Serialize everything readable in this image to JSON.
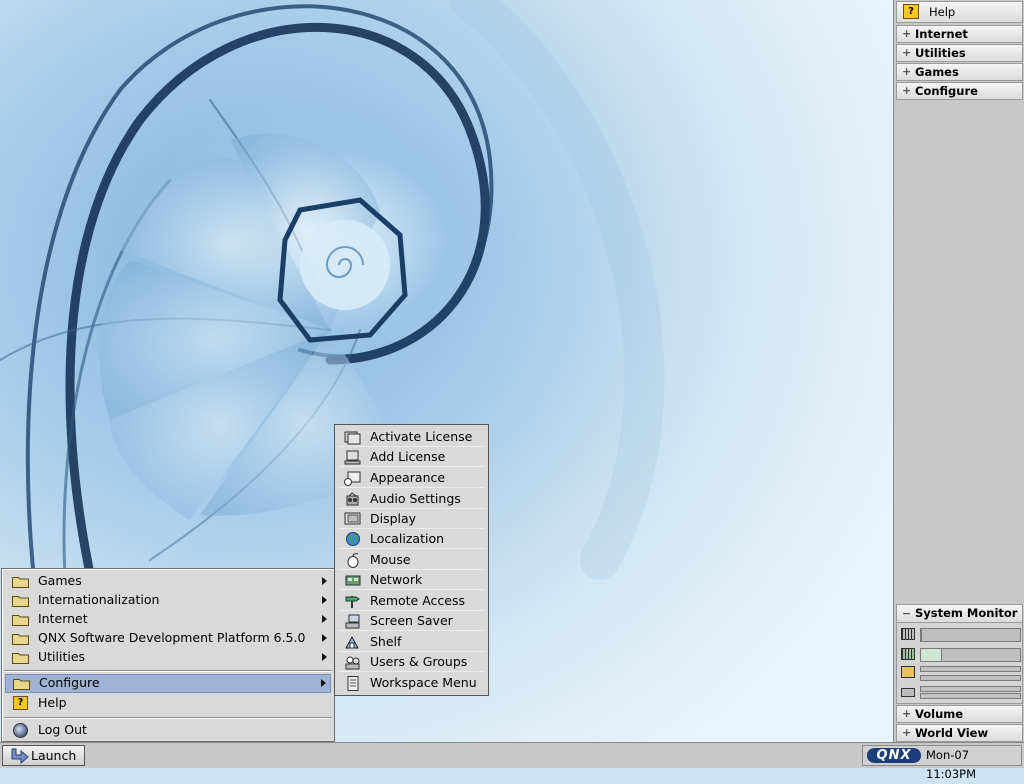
{
  "shelf": {
    "help_label": "Help",
    "groups": [
      {
        "label": "Internet"
      },
      {
        "label": "Utilities"
      },
      {
        "label": "Games"
      },
      {
        "label": "Configure"
      }
    ],
    "system_monitor": {
      "title": "System Monitor",
      "cpu_level": 0,
      "memory_level": 0.2
    },
    "volume_label": "Volume",
    "world_view_label": "World View"
  },
  "launch_menu": {
    "items": [
      {
        "label": "Games",
        "icon": "folder-icon",
        "submenu": true
      },
      {
        "label": "Internationalization",
        "icon": "folder-icon",
        "submenu": true
      },
      {
        "label": "Internet",
        "icon": "folder-icon",
        "submenu": true
      },
      {
        "label": "QNX Software Development Platform 6.5.0",
        "icon": "folder-icon",
        "submenu": true
      },
      {
        "label": "Utilities",
        "icon": "folder-icon",
        "submenu": true
      }
    ],
    "configure_label": "Configure",
    "help_label": "Help",
    "logout_label": "Log Out"
  },
  "configure_menu": {
    "items": [
      {
        "label": "Activate License",
        "icon": "license-icon"
      },
      {
        "label": "Add License",
        "icon": "computer-icon"
      },
      {
        "label": "Appearance",
        "icon": "appearance-icon"
      },
      {
        "label": "Audio Settings",
        "icon": "audio-icon"
      },
      {
        "label": "Display",
        "icon": "display-icon"
      },
      {
        "label": "Localization",
        "icon": "globe-icon"
      },
      {
        "label": "Mouse",
        "icon": "mouse-icon"
      },
      {
        "label": "Network",
        "icon": "network-card-icon"
      },
      {
        "label": "Remote Access",
        "icon": "remote-access-icon"
      },
      {
        "label": "Screen Saver",
        "icon": "screen-saver-icon"
      },
      {
        "label": "Shelf",
        "icon": "shelf-icon"
      },
      {
        "label": "Users & Groups",
        "icon": "users-icon"
      },
      {
        "label": "Workspace Menu",
        "icon": "workspace-menu-icon"
      }
    ]
  },
  "taskbar": {
    "launch_label": "Launch",
    "logo_text": "QNX",
    "clock": "Mon-07 11:03PM"
  }
}
